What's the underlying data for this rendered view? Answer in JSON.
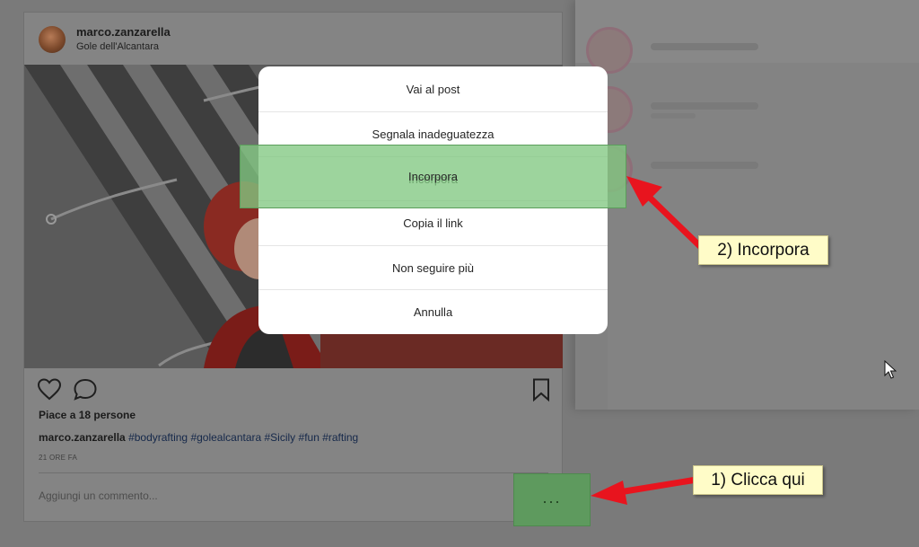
{
  "post": {
    "username": "marco.zanzarella",
    "location": "Gole dell'Alcantara",
    "likes": "Piace a 18 persone",
    "caption_user": "marco.zanzarella",
    "caption_tags": "#bodyrafting #golealcantara #Sicily #fun #rafting",
    "time": "21 ORE FA",
    "comment_placeholder": "Aggiungi un commento...",
    "icons": {
      "like": "heart-icon",
      "comment": "speech-bubble-icon",
      "save": "bookmark-icon"
    }
  },
  "menu": {
    "items": [
      {
        "label": "Vai al post"
      },
      {
        "label": "Segnala inadeguatezza"
      },
      {
        "label": "Incorpora"
      },
      {
        "label": "Copia il link"
      },
      {
        "label": "Non seguire più"
      },
      {
        "label": "Annulla"
      }
    ]
  },
  "more_button": {
    "label": "...",
    "icon": "ellipsis-icon"
  },
  "annotations": {
    "step1": "1) Clicca qui",
    "step2": "2) Incorpora"
  },
  "colors": {
    "highlight": "#82c882",
    "callout_bg": "#fffcc8",
    "arrow": "#e8141e",
    "overlay": "#7b7b7b"
  }
}
